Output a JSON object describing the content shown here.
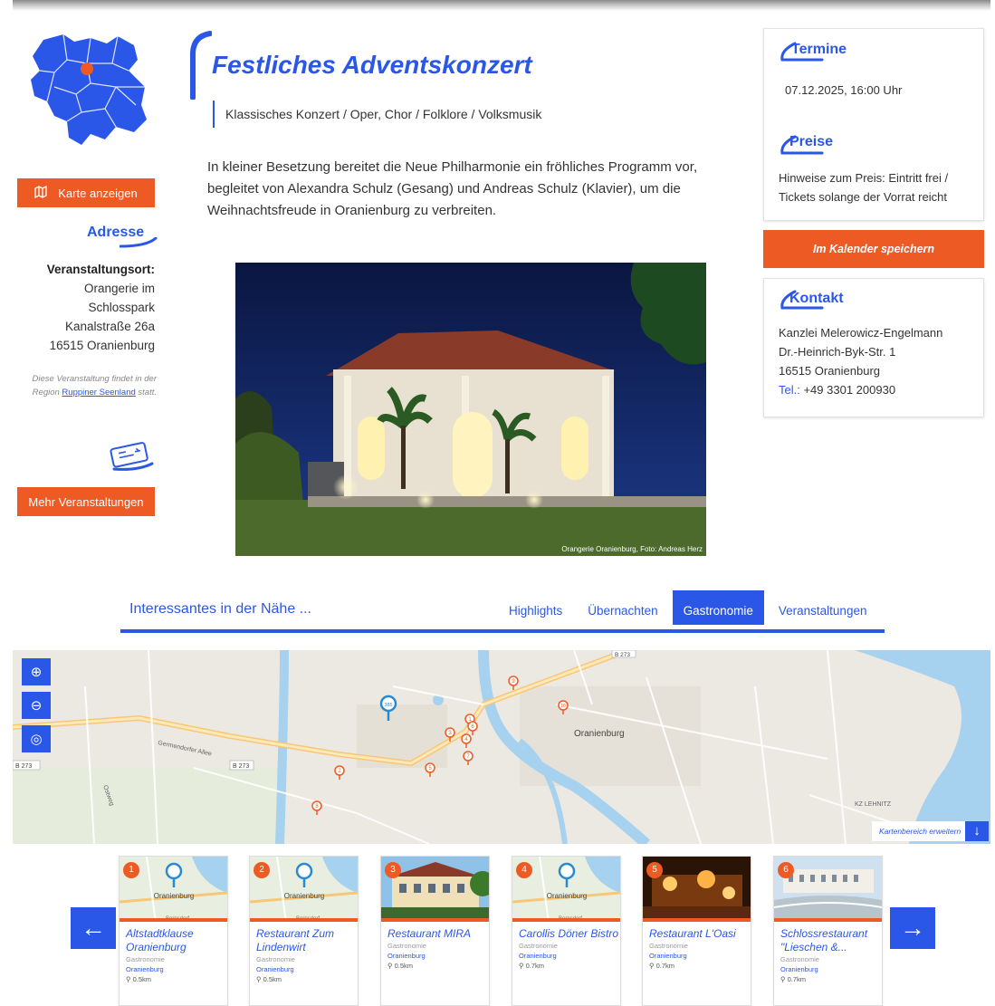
{
  "event": {
    "title": "Festliches Adventskonzert",
    "category": "Klassisches Konzert / Oper, Chor / Folklore / Volksmusik",
    "description": "In kleiner Besetzung bereitet die Neue Philharmonie ein fröhliches Programm vor, begleitet von Alexandra Schulz (Gesang) und Andreas Schulz (Klavier), um die Weihnachtsfreude in Oranienburg zu verbreiten.",
    "photo_caption": "Orangerie Oranienburg, Foto: Andreas Herz"
  },
  "left": {
    "map_button": "Karte anzeigen",
    "address_heading": "Adresse",
    "venue_label": "Veranstaltungsort:",
    "venue_line1": "Orangerie im",
    "venue_line2": "Schlosspark",
    "street": "Kanalstraße 26a",
    "city": "16515 Oranienburg",
    "region_prefix": "Diese Veranstaltung findet in der Region",
    "region_link": "Ruppiner Seenland",
    "region_suffix": "statt.",
    "more_events_button": "Mehr Veranstaltungen"
  },
  "right": {
    "termine_heading": "Termine",
    "termine_value": "07.12.2025, 16:00 Uhr",
    "preise_heading": "Preise",
    "preise_line1": "Hinweise zum Preis: Eintritt frei /",
    "preise_line2": "Tickets solange der Vorrat reicht",
    "calendar_button": "Im Kalender speichern",
    "kontakt_heading": "Kontakt",
    "kontakt_name": "Kanzlei Melerowicz-Engelmann",
    "kontakt_street": "Dr.-Heinrich-Byk-Str. 1",
    "kontakt_city": "16515 Oranienburg",
    "kontakt_tel_label": "Tel.:",
    "kontakt_tel": "+49 3301 200930"
  },
  "nearby": {
    "title": "Interessantes in der Nähe ...",
    "tabs": [
      "Highlights",
      "Übernachten",
      "Gastronomie",
      "Veranstaltungen"
    ],
    "active_tab": "Gastronomie",
    "map_expand": "Kartenbereich erweitern",
    "map_labels": {
      "town": "Oranienburg",
      "street1": "Germendorfer Allee",
      "b273a": "B 273",
      "b273b": "B 273",
      "b273c": "B 273",
      "ostweg": "Ostweg",
      "lehnitz": "KZ LEHNITZ",
      "bornsdorf": "Bornsdorf"
    },
    "map_markers": [
      "1",
      "2",
      "3",
      "4",
      "5",
      "6",
      "7",
      "8",
      "9",
      "10",
      "385"
    ]
  },
  "cards": [
    {
      "num": "1",
      "name": "Altstadtklause Oranienburg",
      "category": "Gastronomie",
      "city": "Oranienburg",
      "distance": "0.5km",
      "img": "map",
      "map_town": "Oranienburg",
      "map_sub": "Bornsdorf"
    },
    {
      "num": "2",
      "name": "Restaurant Zum Lindenwirt",
      "category": "Gastronomie",
      "city": "Oranienburg",
      "distance": "0.5km",
      "img": "map",
      "map_town": "Oranienburg",
      "map_sub": "Bornsdorf"
    },
    {
      "num": "3",
      "name": "Restaurant MIRA",
      "category": "Gastronomie",
      "city": "Oranienburg",
      "distance": "0.5km",
      "img": "photo-house"
    },
    {
      "num": "4",
      "name": "Carollis Döner Bistro",
      "category": "Gastronomie",
      "city": "Oranienburg",
      "distance": "0.7km",
      "img": "map",
      "map_town": "Oranienburg",
      "map_sub": "Bornsdorf"
    },
    {
      "num": "5",
      "name": "Restaurant L'Oasi",
      "category": "Gastronomie",
      "city": "Oranienburg",
      "distance": "0.7km",
      "img": "photo-night"
    },
    {
      "num": "6",
      "name": "Schlossrestaurant \"Lieschen &...",
      "category": "Gastronomie",
      "city": "Oranienburg",
      "distance": "0.7km",
      "img": "photo-castle"
    }
  ],
  "colors": {
    "accent": "#2a57e8",
    "orange": "#ee5a24"
  },
  "icons": [
    "map-icon",
    "ticket-icon",
    "zoom-in-icon",
    "zoom-out-icon",
    "locate-icon",
    "arrow-down-icon",
    "arrow-left-icon",
    "arrow-right-icon",
    "pin-icon"
  ]
}
